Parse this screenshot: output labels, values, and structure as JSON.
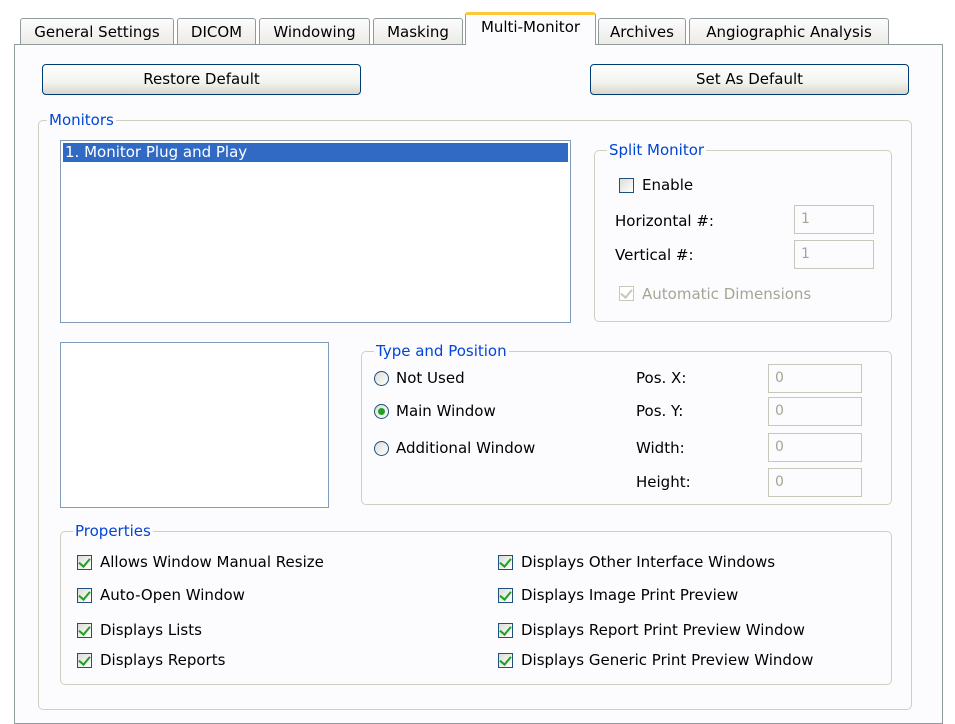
{
  "tabs": [
    {
      "label": "General Settings"
    },
    {
      "label": "DICOM"
    },
    {
      "label": "Windowing"
    },
    {
      "label": "Masking"
    },
    {
      "label": "Multi-Monitor"
    },
    {
      "label": "Archives"
    },
    {
      "label": "Angiographic Analysis"
    }
  ],
  "buttons": {
    "restore_default": "Restore Default",
    "set_as_default": "Set As Default"
  },
  "monitors": {
    "legend": "Monitors",
    "items": [
      "1. Monitor Plug and Play"
    ]
  },
  "split_monitor": {
    "legend": "Split Monitor",
    "enable_label": "Enable",
    "enable_checked": false,
    "horizontal_label": "Horizontal #:",
    "horizontal_value": "1",
    "vertical_label": "Vertical #:",
    "vertical_value": "1",
    "auto_dim_label": "Automatic Dimensions",
    "auto_dim_checked": true
  },
  "type_position": {
    "legend": "Type and Position",
    "options": [
      "Not Used",
      "Main Window",
      "Additional Window"
    ],
    "selected": "Main Window",
    "pos_x_label": "Pos. X:",
    "pos_x_value": "0",
    "pos_y_label": "Pos. Y:",
    "pos_y_value": "0",
    "width_label": "Width:",
    "width_value": "0",
    "height_label": "Height:",
    "height_value": "0"
  },
  "properties": {
    "legend": "Properties",
    "items": [
      {
        "label": "Allows Window Manual Resize",
        "checked": true
      },
      {
        "label": "Auto-Open Window",
        "checked": true
      },
      {
        "label": "Displays Lists",
        "checked": true
      },
      {
        "label": "Displays Reports",
        "checked": true
      },
      {
        "label": "Displays Other Interface Windows",
        "checked": true
      },
      {
        "label": "Displays Image Print Preview",
        "checked": true
      },
      {
        "label": "Displays Report Print Preview Window",
        "checked": true
      },
      {
        "label": "Displays Generic Print Preview Window",
        "checked": true
      }
    ]
  },
  "colors": {
    "legend_blue": "#0046d5",
    "selection_blue": "#316ac5",
    "check_green": "#21a121",
    "active_tab_accent": "#ffc83c"
  }
}
